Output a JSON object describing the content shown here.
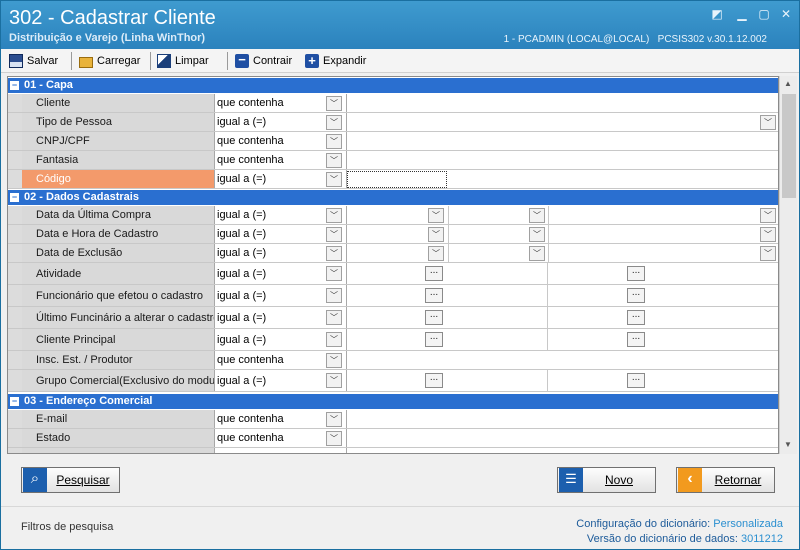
{
  "window": {
    "title": "302 - Cadastrar Cliente",
    "subtitle": "Distribuição e Varejo (Linha WinThor)",
    "session": "1 - PCADMIN (LOCAL@LOCAL)",
    "version": "PCSIS302  v.30.1.12.002"
  },
  "toolbar": {
    "salvar": "Salvar",
    "carregar": "Carregar",
    "limpar": "Limpar",
    "contrair": "Contrair",
    "expandir": "Expandir"
  },
  "groups": [
    {
      "title": "01 - Capa"
    },
    {
      "title": "02 - Dados Cadastrais"
    },
    {
      "title": "03 - Endereço Comercial"
    }
  ],
  "rows": {
    "r0": {
      "label": "Cliente",
      "op": "que contenha"
    },
    "r1": {
      "label": "Tipo de Pessoa",
      "op": "igual a (=)"
    },
    "r2": {
      "label": "CNPJ/CPF",
      "op": "que contenha"
    },
    "r3": {
      "label": "Fantasia",
      "op": "que contenha"
    },
    "r4": {
      "label": "Código",
      "op": "igual a (=)"
    },
    "r5": {
      "label": "Data da Última Compra",
      "op": "igual a (=)"
    },
    "r6": {
      "label": "Data e Hora de Cadastro",
      "op": "igual a (=)"
    },
    "r7": {
      "label": "Data de Exclusão",
      "op": "igual a (=)"
    },
    "r8": {
      "label": "Atividade",
      "op": "igual a (=)"
    },
    "r9": {
      "label": "Funcionário que efetou o cadastro",
      "op": "igual a (=)"
    },
    "r10": {
      "label": "Último Funcinário a alterar o cadastro",
      "op": "igual a (=)"
    },
    "r11": {
      "label": "Cliente Principal",
      "op": "igual a (=)"
    },
    "r12": {
      "label": "Insc. Est. / Produtor",
      "op": "que contenha"
    },
    "r13": {
      "label": "Grupo Comercial(Exclusivo do modulo",
      "op": "igual a (=)"
    },
    "r14": {
      "label": "E-mail",
      "op": "que contenha"
    },
    "r15": {
      "label": "Estado",
      "op": "que contenha"
    }
  },
  "buttons": {
    "pesquisar": "Pesquisar",
    "novo": "Novo",
    "retornar": "Retornar"
  },
  "ellipsis": "...",
  "footer": {
    "left": "Filtros de pesquisa",
    "config_label": "Configuração do dicionário:",
    "config_value": "Personalizada",
    "version_label": "Versão do dicionário de dados:",
    "version_value": "3011212"
  }
}
